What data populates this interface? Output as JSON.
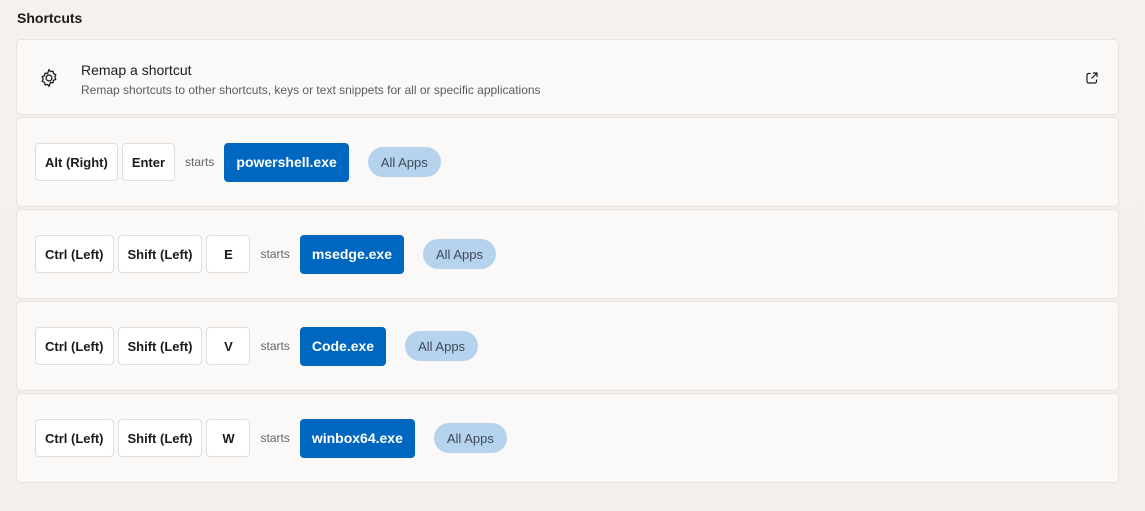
{
  "section": {
    "title": "Shortcuts"
  },
  "remap": {
    "icon": "gear-icon",
    "title": "Remap a shortcut",
    "description": "Remap shortcuts to other shortcuts, keys or text snippets for all or specific applications",
    "link_icon": "external-link-icon"
  },
  "shortcuts": [
    {
      "keys": [
        "Alt (Right)",
        "Enter"
      ],
      "action": "starts",
      "app": "powershell.exe",
      "scope": "All Apps"
    },
    {
      "keys": [
        "Ctrl (Left)",
        "Shift (Left)",
        "E"
      ],
      "action": "starts",
      "app": "msedge.exe",
      "scope": "All Apps"
    },
    {
      "keys": [
        "Ctrl (Left)",
        "Shift (Left)",
        "V"
      ],
      "action": "starts",
      "app": "Code.exe",
      "scope": "All Apps"
    },
    {
      "keys": [
        "Ctrl (Left)",
        "Shift (Left)",
        "W"
      ],
      "action": "starts",
      "app": "winbox64.exe",
      "scope": "All Apps"
    }
  ],
  "colors": {
    "accent": "#0067c0",
    "pill_background": "#b6d3ee",
    "card_background": "#fbf9f8"
  }
}
